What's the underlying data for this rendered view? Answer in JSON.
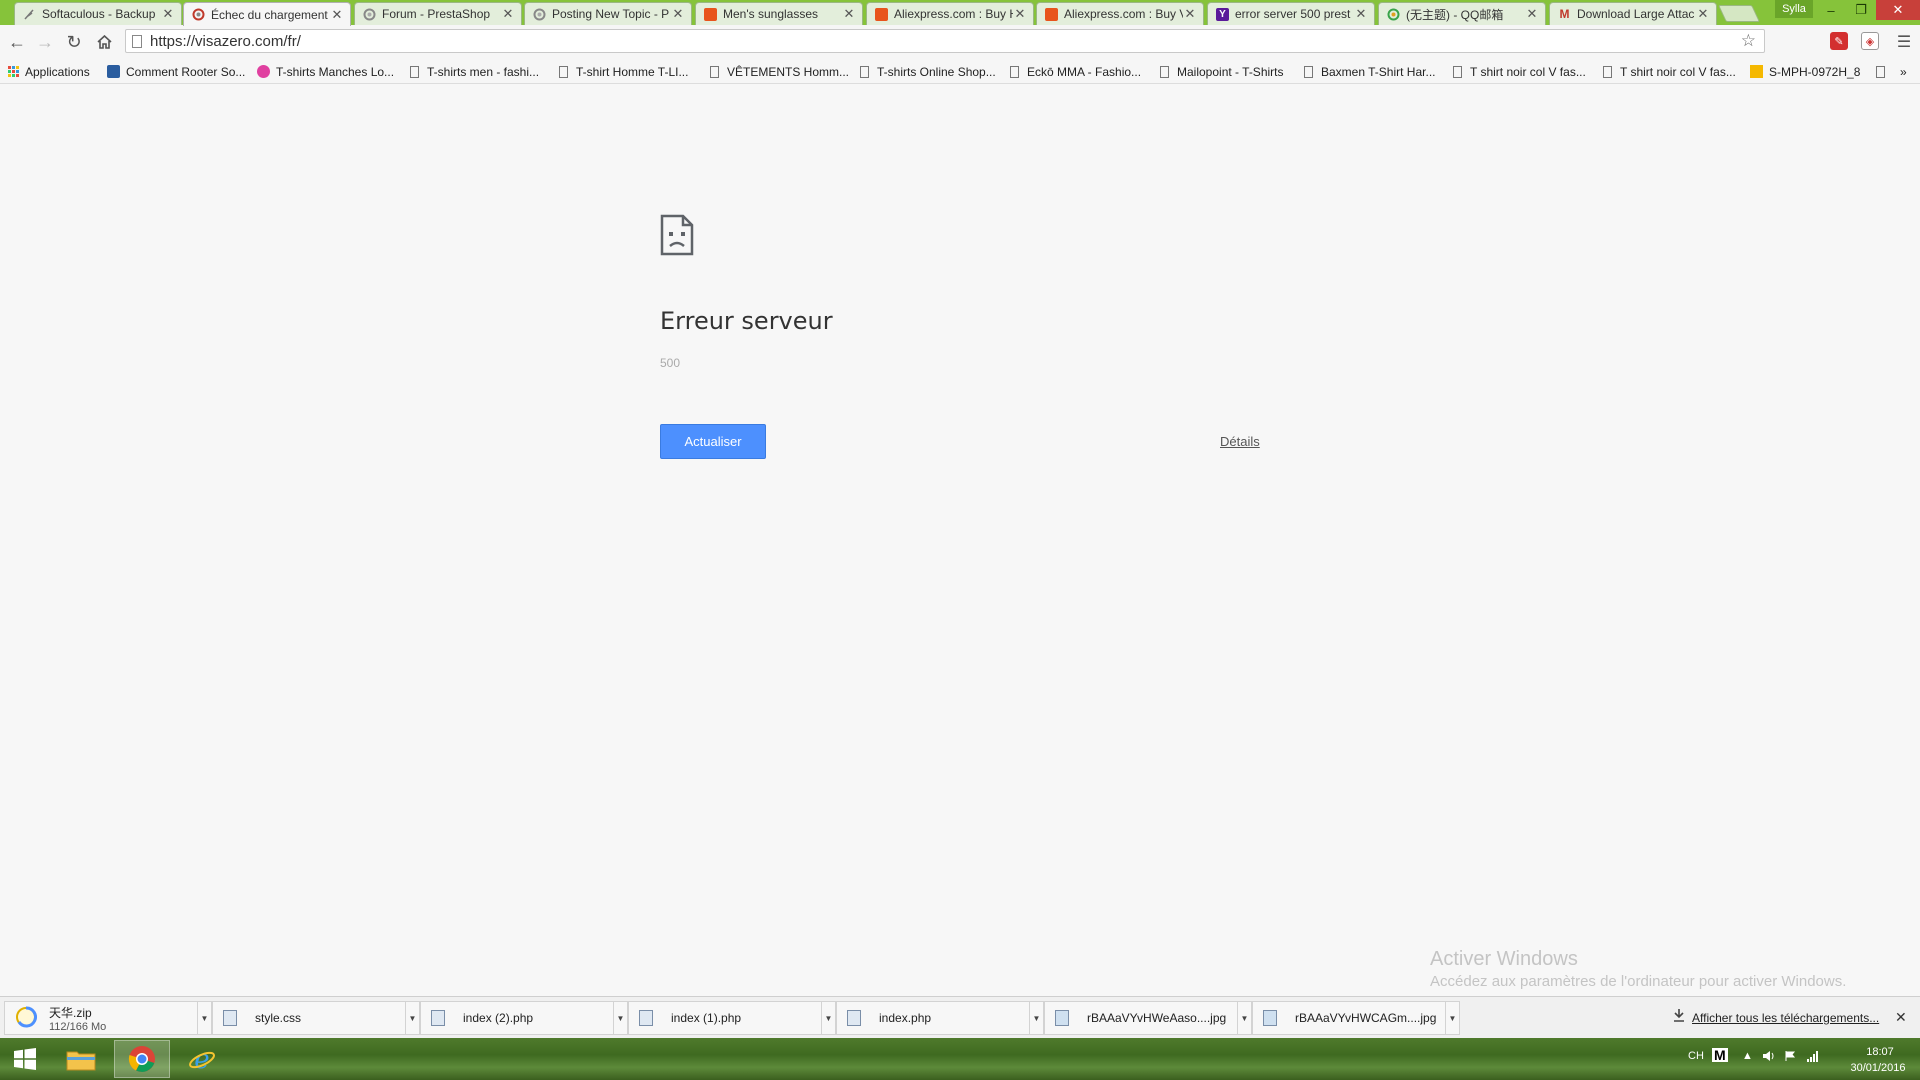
{
  "browser": {
    "tabs": [
      {
        "title": "Softaculous - Backup",
        "active": false,
        "favicon_color": "#8a8a8a",
        "favicon": "feather-icon"
      },
      {
        "title": "Échec du chargement",
        "active": true,
        "favicon_color": "#c0392b",
        "favicon": "cloud-icon"
      },
      {
        "title": "Forum - PrestaShop",
        "active": false,
        "favicon_color": "#8a8a8a",
        "favicon": "cloud-icon"
      },
      {
        "title": "Posting New Topic - P",
        "active": false,
        "favicon_color": "#8a8a8a",
        "favicon": "cloud-icon"
      },
      {
        "title": "Men's sunglasses",
        "active": false,
        "favicon_color": "#e8541c",
        "favicon": "shop-icon"
      },
      {
        "title": "Aliexpress.com : Buy H",
        "active": false,
        "favicon_color": "#e8541c",
        "favicon": "shop-icon"
      },
      {
        "title": "Aliexpress.com : Buy V",
        "active": false,
        "favicon_color": "#e8541c",
        "favicon": "shop-icon"
      },
      {
        "title": "error server 500 prest",
        "active": false,
        "favicon_color": "#5a1a9a",
        "favicon": "yahoo-icon",
        "glyph": "Y"
      },
      {
        "title": "(无主题) - QQ邮箱",
        "active": false,
        "favicon_color": "#3aa34a",
        "favicon": "qq-icon"
      },
      {
        "title": "Download Large Attac",
        "active": false,
        "favicon_color": "#c0392b",
        "favicon": "gmail-icon",
        "glyph": "M"
      }
    ],
    "profile_name": "Sylla",
    "url": "https://visazero.com/fr/"
  },
  "bookmarks": [
    {
      "label": "Applications",
      "icon": "apps-icon"
    },
    {
      "label": "Comment Rooter So...",
      "icon": "site-icon"
    },
    {
      "label": "T-shirts Manches Lo...",
      "icon": "flower-icon"
    },
    {
      "label": "T-shirts men - fashi...",
      "icon": "page-icon"
    },
    {
      "label": "T-shirt Homme T-LI...",
      "icon": "page-icon"
    },
    {
      "label": "VÊTEMENTS Homm...",
      "icon": "page-icon"
    },
    {
      "label": "T-shirts Online Shop...",
      "icon": "page-icon"
    },
    {
      "label": "Eckō MMA - Fashio...",
      "icon": "page-icon"
    },
    {
      "label": "Mailopoint - T-Shirts",
      "icon": "page-icon"
    },
    {
      "label": "Baxmen T-Shirt Har...",
      "icon": "page-icon"
    },
    {
      "label": "T shirt noir col V fas...",
      "icon": "page-icon"
    },
    {
      "label": "T shirt noir col V fas...",
      "icon": "page-icon"
    },
    {
      "label": "S-MPH-0972H_8",
      "icon": "bolt-icon"
    }
  ],
  "error_page": {
    "title": "Erreur serveur",
    "code": "500",
    "reload_label": "Actualiser",
    "details_label": "Détails"
  },
  "watermark": {
    "line1": "Activer Windows",
    "line2": "Accédez aux paramètres de l'ordinateur pour activer Windows."
  },
  "downloads": {
    "items": [
      {
        "name": "天华.zip",
        "progress": "112/166 Mo"
      },
      {
        "name": "style.css"
      },
      {
        "name": "index (2).php"
      },
      {
        "name": "index (1).php"
      },
      {
        "name": "index.php"
      },
      {
        "name": "rBAAaVYvHWeAaso....jpg"
      },
      {
        "name": "rBAAaVYvHWCAGm....jpg"
      }
    ],
    "show_all_label": "Afficher tous les téléchargements..."
  },
  "taskbar": {
    "lang": "CH",
    "time": "18:07",
    "date": "30/01/2016"
  },
  "colors": {
    "accent": "#4d90fe",
    "titlebar": "#86c33a"
  }
}
